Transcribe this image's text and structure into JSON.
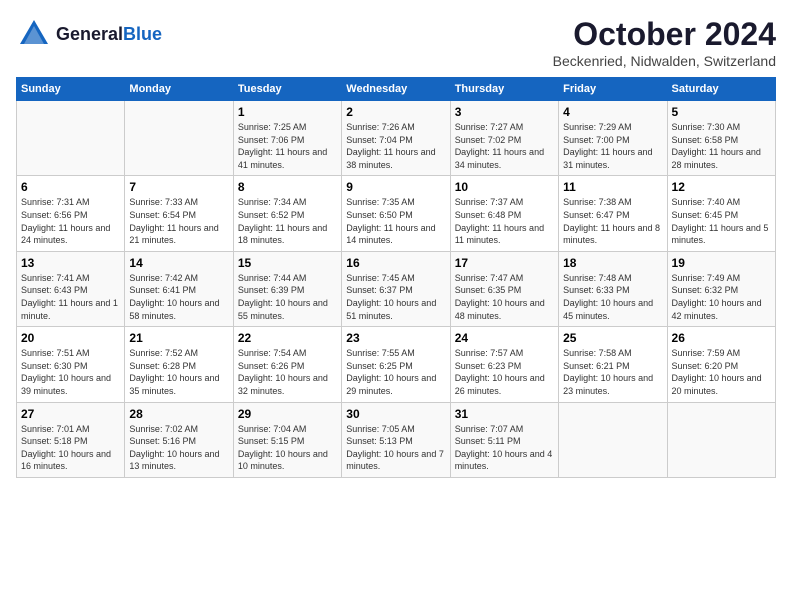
{
  "logo": {
    "general": "General",
    "blue": "Blue"
  },
  "header": {
    "month": "October 2024",
    "location": "Beckenried, Nidwalden, Switzerland"
  },
  "weekdays": [
    "Sunday",
    "Monday",
    "Tuesday",
    "Wednesday",
    "Thursday",
    "Friday",
    "Saturday"
  ],
  "weeks": [
    [
      {
        "day": "",
        "info": ""
      },
      {
        "day": "",
        "info": ""
      },
      {
        "day": "1",
        "info": "Sunrise: 7:25 AM\nSunset: 7:06 PM\nDaylight: 11 hours and 41 minutes."
      },
      {
        "day": "2",
        "info": "Sunrise: 7:26 AM\nSunset: 7:04 PM\nDaylight: 11 hours and 38 minutes."
      },
      {
        "day": "3",
        "info": "Sunrise: 7:27 AM\nSunset: 7:02 PM\nDaylight: 11 hours and 34 minutes."
      },
      {
        "day": "4",
        "info": "Sunrise: 7:29 AM\nSunset: 7:00 PM\nDaylight: 11 hours and 31 minutes."
      },
      {
        "day": "5",
        "info": "Sunrise: 7:30 AM\nSunset: 6:58 PM\nDaylight: 11 hours and 28 minutes."
      }
    ],
    [
      {
        "day": "6",
        "info": "Sunrise: 7:31 AM\nSunset: 6:56 PM\nDaylight: 11 hours and 24 minutes."
      },
      {
        "day": "7",
        "info": "Sunrise: 7:33 AM\nSunset: 6:54 PM\nDaylight: 11 hours and 21 minutes."
      },
      {
        "day": "8",
        "info": "Sunrise: 7:34 AM\nSunset: 6:52 PM\nDaylight: 11 hours and 18 minutes."
      },
      {
        "day": "9",
        "info": "Sunrise: 7:35 AM\nSunset: 6:50 PM\nDaylight: 11 hours and 14 minutes."
      },
      {
        "day": "10",
        "info": "Sunrise: 7:37 AM\nSunset: 6:48 PM\nDaylight: 11 hours and 11 minutes."
      },
      {
        "day": "11",
        "info": "Sunrise: 7:38 AM\nSunset: 6:47 PM\nDaylight: 11 hours and 8 minutes."
      },
      {
        "day": "12",
        "info": "Sunrise: 7:40 AM\nSunset: 6:45 PM\nDaylight: 11 hours and 5 minutes."
      }
    ],
    [
      {
        "day": "13",
        "info": "Sunrise: 7:41 AM\nSunset: 6:43 PM\nDaylight: 11 hours and 1 minute."
      },
      {
        "day": "14",
        "info": "Sunrise: 7:42 AM\nSunset: 6:41 PM\nDaylight: 10 hours and 58 minutes."
      },
      {
        "day": "15",
        "info": "Sunrise: 7:44 AM\nSunset: 6:39 PM\nDaylight: 10 hours and 55 minutes."
      },
      {
        "day": "16",
        "info": "Sunrise: 7:45 AM\nSunset: 6:37 PM\nDaylight: 10 hours and 51 minutes."
      },
      {
        "day": "17",
        "info": "Sunrise: 7:47 AM\nSunset: 6:35 PM\nDaylight: 10 hours and 48 minutes."
      },
      {
        "day": "18",
        "info": "Sunrise: 7:48 AM\nSunset: 6:33 PM\nDaylight: 10 hours and 45 minutes."
      },
      {
        "day": "19",
        "info": "Sunrise: 7:49 AM\nSunset: 6:32 PM\nDaylight: 10 hours and 42 minutes."
      }
    ],
    [
      {
        "day": "20",
        "info": "Sunrise: 7:51 AM\nSunset: 6:30 PM\nDaylight: 10 hours and 39 minutes."
      },
      {
        "day": "21",
        "info": "Sunrise: 7:52 AM\nSunset: 6:28 PM\nDaylight: 10 hours and 35 minutes."
      },
      {
        "day": "22",
        "info": "Sunrise: 7:54 AM\nSunset: 6:26 PM\nDaylight: 10 hours and 32 minutes."
      },
      {
        "day": "23",
        "info": "Sunrise: 7:55 AM\nSunset: 6:25 PM\nDaylight: 10 hours and 29 minutes."
      },
      {
        "day": "24",
        "info": "Sunrise: 7:57 AM\nSunset: 6:23 PM\nDaylight: 10 hours and 26 minutes."
      },
      {
        "day": "25",
        "info": "Sunrise: 7:58 AM\nSunset: 6:21 PM\nDaylight: 10 hours and 23 minutes."
      },
      {
        "day": "26",
        "info": "Sunrise: 7:59 AM\nSunset: 6:20 PM\nDaylight: 10 hours and 20 minutes."
      }
    ],
    [
      {
        "day": "27",
        "info": "Sunrise: 7:01 AM\nSunset: 5:18 PM\nDaylight: 10 hours and 16 minutes."
      },
      {
        "day": "28",
        "info": "Sunrise: 7:02 AM\nSunset: 5:16 PM\nDaylight: 10 hours and 13 minutes."
      },
      {
        "day": "29",
        "info": "Sunrise: 7:04 AM\nSunset: 5:15 PM\nDaylight: 10 hours and 10 minutes."
      },
      {
        "day": "30",
        "info": "Sunrise: 7:05 AM\nSunset: 5:13 PM\nDaylight: 10 hours and 7 minutes."
      },
      {
        "day": "31",
        "info": "Sunrise: 7:07 AM\nSunset: 5:11 PM\nDaylight: 10 hours and 4 minutes."
      },
      {
        "day": "",
        "info": ""
      },
      {
        "day": "",
        "info": ""
      }
    ]
  ]
}
